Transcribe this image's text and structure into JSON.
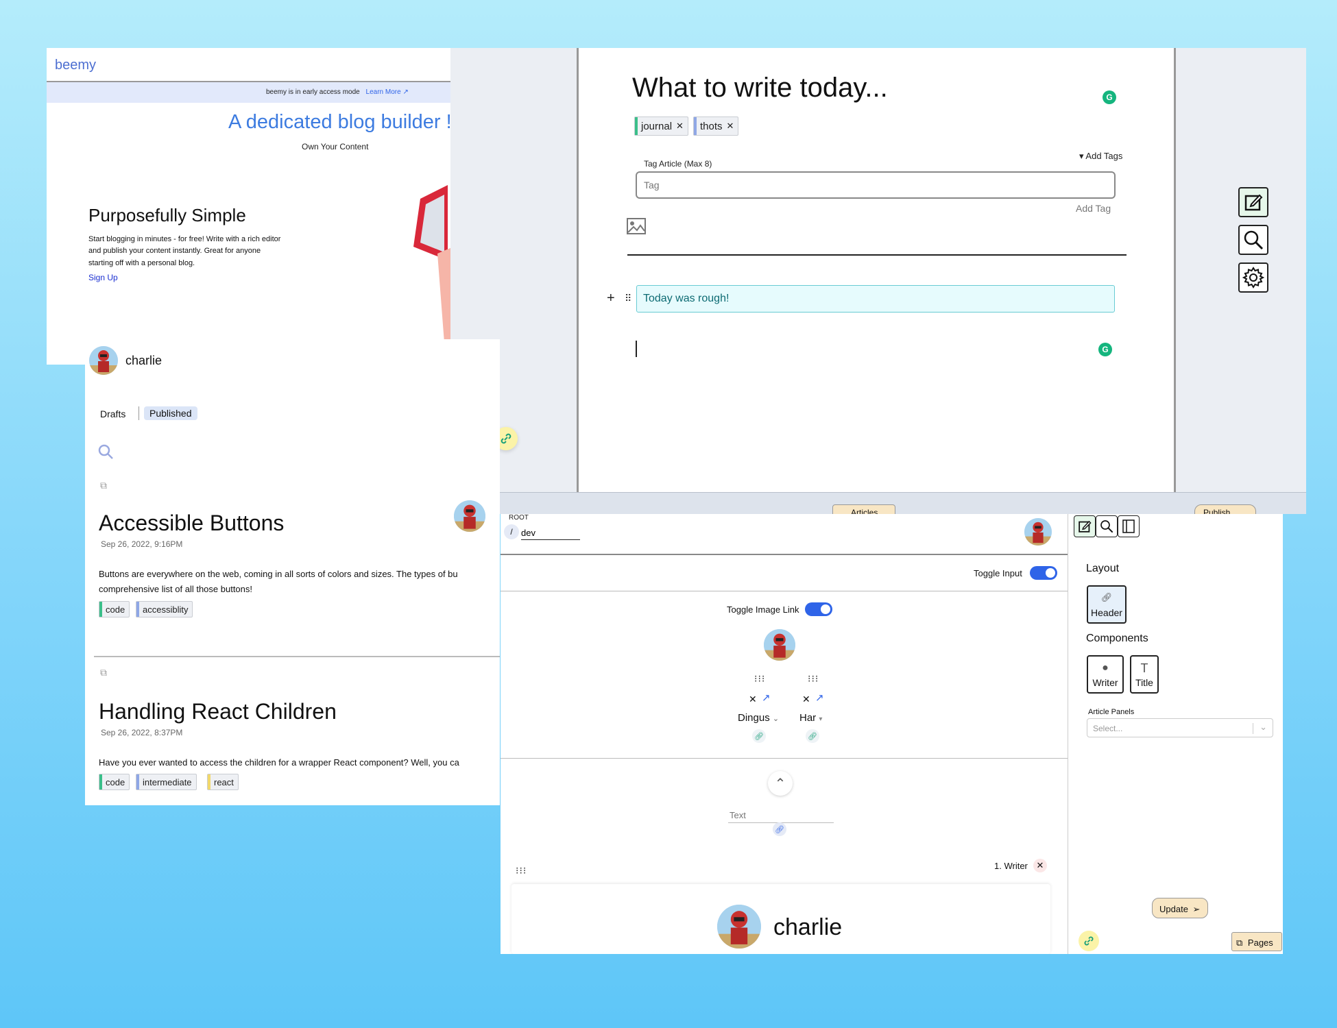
{
  "landing": {
    "logo": "beemy",
    "banner_text": "beemy is in early access mode",
    "banner_link": "Learn More",
    "hero_title": "A dedicated blog builder !",
    "hero_subtitle": "Own Your Content",
    "feature_title": "Purposefully Simple",
    "feature_text_1": "Start blogging in minutes - for free! Write with a rich editor",
    "feature_text_2": "and publish your content instantly. Great for anyone",
    "feature_text_3": "starting off with a personal blog.",
    "signup_link": "Sign Up"
  },
  "profile": {
    "username": "charlie",
    "tabs": [
      "Drafts",
      "Published"
    ],
    "articles": [
      {
        "title": "Accessible Buttons",
        "date": "Sep 26, 2022, 9:16PM",
        "excerpt_1": "Buttons are everywhere on the web, coming in all sorts of colors and sizes. The types of bu",
        "excerpt_2": "comprehensive list of all those buttons!",
        "tags": [
          "code",
          "accessiblity"
        ]
      },
      {
        "title": "Handling React Children",
        "date": "Sep 26, 2022, 8:37PM",
        "excerpt_1": "Have you ever wanted to access the children for a wrapper React component? Well, you ca",
        "excerpt_2": "",
        "tags": [
          "code",
          "intermediate",
          "react"
        ]
      }
    ],
    "tag_colors": {
      "code": "#3bbf8a",
      "accessiblity": "#8fa7e6",
      "intermediate": "#8fa7e6",
      "react": "#f2d86a"
    }
  },
  "editor": {
    "title": "What to write today...",
    "tags": [
      "journal",
      "thots"
    ],
    "add_tags_toggle": "▾ Add Tags",
    "tag_field_label": "Tag Article (Max 8)",
    "tag_placeholder": "Tag",
    "add_tag_button": "Add Tag",
    "block_text": "Today was rough!",
    "bottom_articles_label": "Articles",
    "bottom_publish_label": "Publish"
  },
  "builder": {
    "root_label": "ROOT",
    "path_slash": "/",
    "path_value": "dev",
    "toggle_input_label": "Toggle Input",
    "toggle_image_link_label": "Toggle Image Link",
    "link_1": "Dingus",
    "link_2": "Har",
    "text_placeholder": "Text",
    "writer_label": "1. Writer",
    "writer_name": "charlie"
  },
  "sidebar": {
    "layout_heading": "Layout",
    "header_button": "Header",
    "components_heading": "Components",
    "writer_button": "Writer",
    "title_button": "Title",
    "article_panels_label": "Article Panels",
    "select_placeholder": "Select...",
    "update_button": "Update",
    "pages_button": "Pages"
  },
  "colors": {
    "accent_blue": "#3c7be0",
    "toggle_blue": "#2f64e8",
    "link_yellow": "#fbf3a8",
    "link_green": "#1aa07a",
    "grammarly_green": "#15b57e",
    "block_bg": "#e6fbfd",
    "peach": "#f8e6c4"
  }
}
